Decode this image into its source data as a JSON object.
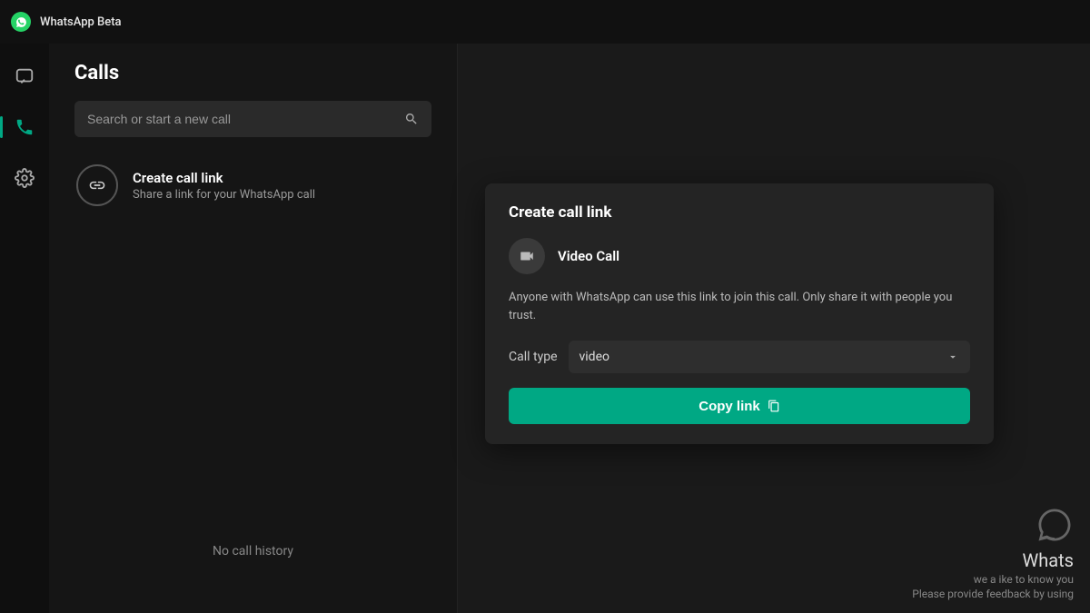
{
  "app": {
    "title": "WhatsApp Beta"
  },
  "nav": {
    "items": [
      "chats",
      "calls",
      "settings"
    ],
    "active": "calls"
  },
  "calls": {
    "title": "Calls",
    "search_placeholder": "Search or start a new call",
    "create_link": {
      "title": "Create call link",
      "subtitle": "Share a link for your WhatsApp call"
    },
    "no_history": "No call history"
  },
  "dialog": {
    "title": "Create call link",
    "call_label": "Video Call",
    "info": "Anyone with WhatsApp can use this link to join this call. Only share it with people you trust.",
    "type_label": "Call type",
    "type_value": "video",
    "copy_button": "Copy link"
  },
  "feedback": {
    "brand": "Whats",
    "line1": "we a ike to know you",
    "line2": "Please provide feedback by using"
  },
  "colors": {
    "accent": "#00a884",
    "brand": "#25D366"
  }
}
